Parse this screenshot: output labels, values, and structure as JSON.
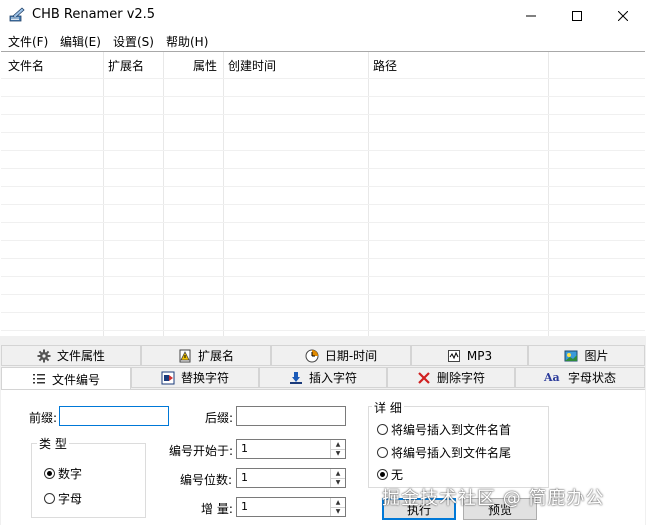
{
  "window": {
    "title": "CHB Renamer v2.5",
    "icon": "pencil-app-icon"
  },
  "menu": {
    "items": [
      "文件(F)",
      "编辑(E)",
      "设置(S)",
      "帮助(H)"
    ]
  },
  "list": {
    "columns": [
      "文件名",
      "扩展名",
      "属性",
      "创建时间",
      "路径"
    ]
  },
  "tabs": {
    "row1": [
      {
        "label": "文件属性",
        "icon": "gear-icon"
      },
      {
        "label": "扩展名",
        "icon": "warning-doc-icon"
      },
      {
        "label": "日期-时间",
        "icon": "clock-icon"
      },
      {
        "label": "MP3",
        "icon": "audio-file-icon"
      },
      {
        "label": "图片",
        "icon": "picture-icon"
      }
    ],
    "row2": [
      {
        "label": "文件编号",
        "icon": "list-icon"
      },
      {
        "label": "替换字符",
        "icon": "replace-icon"
      },
      {
        "label": "插入字符",
        "icon": "insert-icon"
      },
      {
        "label": "删除字符",
        "icon": "delete-x-icon"
      },
      {
        "label": "字母状态",
        "icon": "letter-case-icon"
      }
    ],
    "active": "文件编号"
  },
  "numbering": {
    "prefix_label": "前缀:",
    "prefix_value": "",
    "suffix_label": "后缀:",
    "suffix_value": "",
    "type_label": "类 型",
    "type_options": [
      "数字",
      "字母"
    ],
    "type_selected": "数字",
    "start_label": "编号开始于:",
    "start_value": "1",
    "digits_label": "编号位数:",
    "digits_value": "1",
    "step_label": "增 量:",
    "step_value": "1",
    "detail_label": "详 细",
    "detail_options": [
      "将编号插入到文件名首",
      "将编号插入到文件名尾",
      "无"
    ],
    "detail_selected": "无",
    "execute_label": "执行",
    "preview_label": "预览"
  },
  "watermark": "掘金技术社区 @ 简鹿办公",
  "colors": {
    "accent": "#0078d7",
    "panel": "#f0f0f0"
  }
}
